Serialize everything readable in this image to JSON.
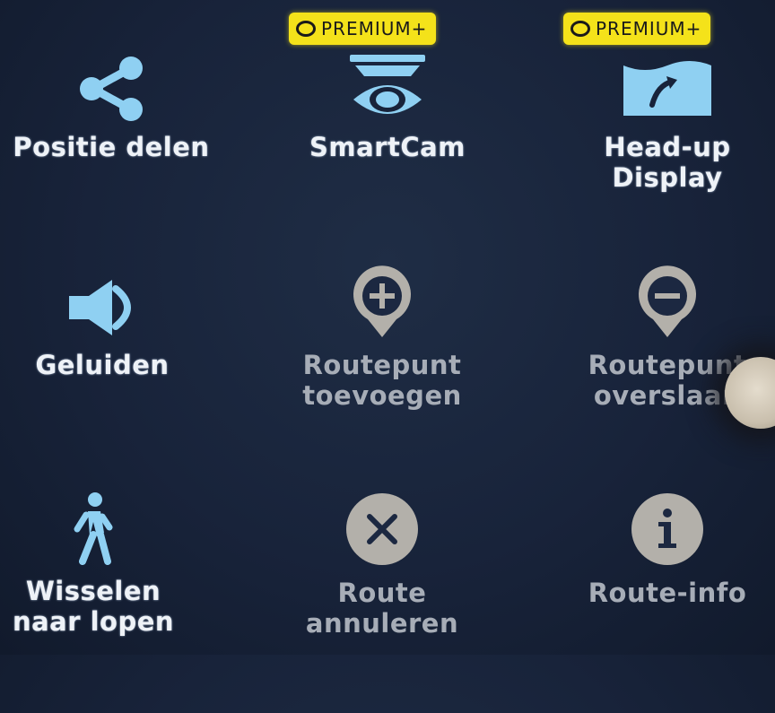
{
  "colors": {
    "background": "#18233a",
    "active_icon": "#8fd0f2",
    "disabled_icon": "#b3b0aa",
    "badge": "#f4e21a"
  },
  "badges": [
    {
      "label": "PREMIUM+",
      "icon": "coin-icon"
    },
    {
      "label": "PREMIUM+",
      "icon": "coin-icon"
    }
  ],
  "items": [
    {
      "label": "Positie delen",
      "icon": "share-icon",
      "enabled": true
    },
    {
      "label": "SmartCam",
      "icon": "smartcam-eye-icon",
      "enabled": true
    },
    {
      "label": "Head-up\nDisplay",
      "icon": "head-up-display-icon",
      "enabled": true
    },
    {
      "label": "Geluiden",
      "icon": "speaker-icon",
      "enabled": true
    },
    {
      "label": "Routepunt\ntoevoegen",
      "icon": "add-waypoint-icon",
      "enabled": false
    },
    {
      "label": "Routepunt\noverslaan",
      "icon": "skip-waypoint-icon",
      "enabled": false
    },
    {
      "label": "Wisselen\nnaar lopen",
      "icon": "walking-person-icon",
      "enabled": true
    },
    {
      "label": "Route\nannuleren",
      "icon": "cancel-route-icon",
      "enabled": false
    },
    {
      "label": "Route-info",
      "icon": "route-info-icon",
      "enabled": false
    }
  ]
}
